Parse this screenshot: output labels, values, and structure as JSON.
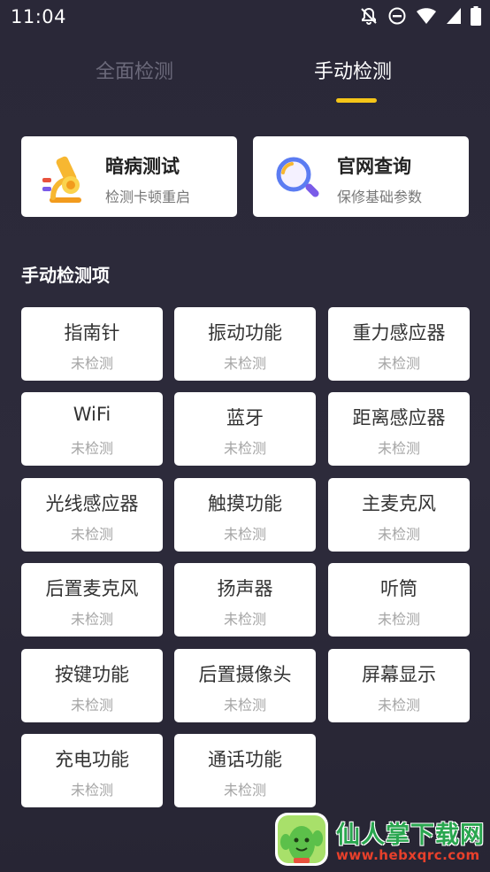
{
  "status_bar": {
    "time": "11:04",
    "icons": [
      "notifications-off-icon",
      "do-not-disturb-icon",
      "wifi-icon",
      "signal-icon",
      "battery-icon"
    ]
  },
  "tabs": [
    {
      "label": "全面检测",
      "active": false
    },
    {
      "label": "手动检测",
      "active": true
    }
  ],
  "accent_color": "#f5c518",
  "top_cards": {
    "dark_test": {
      "title": "暗病测试",
      "subtitle": "检测卡顿重启",
      "icon": "microscope-icon"
    },
    "official_query": {
      "title": "官网查询",
      "subtitle": "保修基础参数",
      "icon": "magnifier-icon"
    }
  },
  "section": {
    "title": "手动检测项"
  },
  "items": [
    {
      "name": "指南针",
      "status": "未检测"
    },
    {
      "name": "振动功能",
      "status": "未检测"
    },
    {
      "name": "重力感应器",
      "status": "未检测"
    },
    {
      "name": "WiFi",
      "status": "未检测"
    },
    {
      "name": "蓝牙",
      "status": "未检测"
    },
    {
      "name": "距离感应器",
      "status": "未检测"
    },
    {
      "name": "光线感应器",
      "status": "未检测"
    },
    {
      "name": "触摸功能",
      "status": "未检测"
    },
    {
      "name": "主麦克风",
      "status": "未检测"
    },
    {
      "name": "后置麦克风",
      "status": "未检测"
    },
    {
      "name": "扬声器",
      "status": "未检测"
    },
    {
      "name": "听筒",
      "status": "未检测"
    },
    {
      "name": "按键功能",
      "status": "未检测"
    },
    {
      "name": "后置摄像头",
      "status": "未检测"
    },
    {
      "name": "屏幕显示",
      "status": "未检测"
    },
    {
      "name": "充电功能",
      "status": "未检测"
    },
    {
      "name": "通话功能",
      "status": "未检测"
    }
  ],
  "watermark": {
    "text": "仙人掌下载网",
    "url": "www.hebxqrc.com"
  }
}
